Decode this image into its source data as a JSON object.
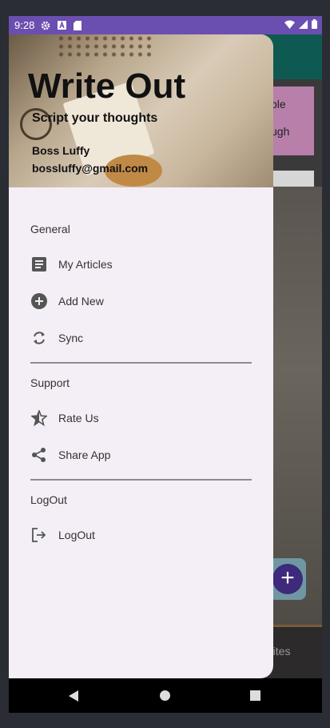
{
  "status_bar": {
    "time": "9:28"
  },
  "background_app": {
    "card_line1": "ple",
    "card_line2": "ugh",
    "bottom_tab": "rites"
  },
  "header": {
    "title": "Write Out",
    "subtitle": "Script your thoughts",
    "user_name": "Boss Luffy",
    "user_email": "bossluffy@gmail.com"
  },
  "sections": {
    "general": "General",
    "support": "Support",
    "logout": "LogOut"
  },
  "items": {
    "my_articles": "My Articles",
    "add_new": "Add New",
    "sync": "Sync",
    "rate_us": "Rate Us",
    "share_app": "Share App",
    "logout": "LogOut"
  },
  "icons": {
    "my_articles": "article-icon",
    "add_new": "add-circle-icon",
    "sync": "sync-icon",
    "rate_us": "star-half-icon",
    "share_app": "share-icon",
    "logout": "logout-icon"
  },
  "colors": {
    "status_bar": "#6b4fb0",
    "drawer_bg": "#f4eef6",
    "toolbar": "#0e5a52",
    "fab": "#3d2a7a"
  }
}
